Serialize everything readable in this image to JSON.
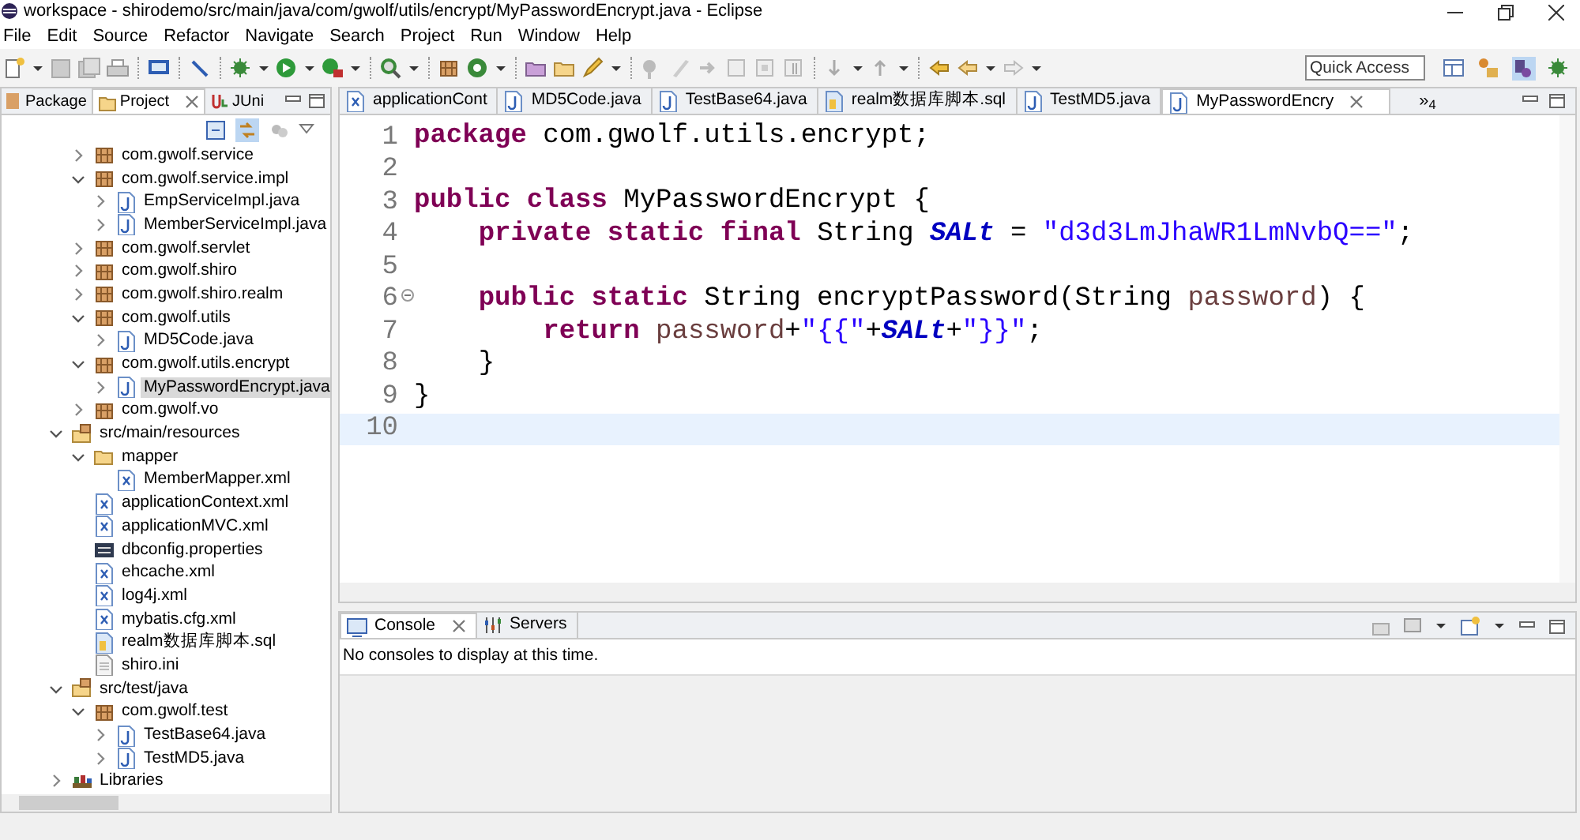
{
  "window": {
    "title": "workspace - shirodemo/src/main/java/com/gwolf/utils/encrypt/MyPasswordEncrypt.java - Eclipse"
  },
  "menu": [
    "File",
    "Edit",
    "Source",
    "Refactor",
    "Navigate",
    "Search",
    "Project",
    "Run",
    "Window",
    "Help"
  ],
  "quick_access": {
    "placeholder": "Quick Access"
  },
  "explorer": {
    "tabs": [
      {
        "label": "Package",
        "selected": false
      },
      {
        "label": "Project",
        "selected": true
      },
      {
        "label": "JUni",
        "selected": false
      }
    ],
    "tree": {
      "continued_children": [
        {
          "label": "com.gwolf.service",
          "kind": "package",
          "expanded": false,
          "selected": false
        },
        {
          "label": "com.gwolf.service.impl",
          "kind": "package",
          "expanded": true,
          "selected": false,
          "children": [
            {
              "label": "EmpServiceImpl.java",
              "kind": "java",
              "expanded": false,
              "selected": false
            },
            {
              "label": "MemberServiceImpl.java",
              "kind": "java",
              "expanded": false,
              "selected": false
            }
          ]
        },
        {
          "label": "com.gwolf.servlet",
          "kind": "package",
          "expanded": false,
          "selected": false
        },
        {
          "label": "com.gwolf.shiro",
          "kind": "package",
          "expanded": false,
          "selected": false
        },
        {
          "label": "com.gwolf.shiro.realm",
          "kind": "package",
          "expanded": false,
          "selected": false
        },
        {
          "label": "com.gwolf.utils",
          "kind": "package",
          "expanded": true,
          "selected": false,
          "children": [
            {
              "label": "MD5Code.java",
              "kind": "java",
              "expanded": false,
              "selected": false
            }
          ]
        },
        {
          "label": "com.gwolf.utils.encrypt",
          "kind": "package",
          "expanded": true,
          "selected": false,
          "children": [
            {
              "label": "MyPasswordEncrypt.java",
              "kind": "java",
              "expanded": false,
              "selected": true
            }
          ]
        },
        {
          "label": "com.gwolf.vo",
          "kind": "package",
          "expanded": false,
          "selected": false
        }
      ],
      "items": [
        {
          "label": "src/main/resources",
          "kind": "source_folder",
          "expanded": true,
          "selected": false,
          "children": [
            {
              "label": "mapper",
              "kind": "folder",
              "expanded": true,
              "selected": false,
              "children": [
                {
                  "label": "MemberMapper.xml",
                  "kind": "xml",
                  "selected": false
                }
              ]
            },
            {
              "label": "applicationContext.xml",
              "kind": "xml",
              "selected": false
            },
            {
              "label": "applicationMVC.xml",
              "kind": "xml",
              "selected": false
            },
            {
              "label": "dbconfig.properties",
              "kind": "properties",
              "selected": false
            },
            {
              "label": "ehcache.xml",
              "kind": "xml",
              "selected": false
            },
            {
              "label": "log4j.xml",
              "kind": "xml",
              "selected": false
            },
            {
              "label": "mybatis.cfg.xml",
              "kind": "xml",
              "selected": false
            },
            {
              "label": "realm数据库脚本.sql",
              "kind": "sql",
              "selected": false
            },
            {
              "label": "shiro.ini",
              "kind": "text",
              "selected": false
            }
          ]
        },
        {
          "label": "src/test/java",
          "kind": "source_folder",
          "expanded": true,
          "selected": false,
          "children": [
            {
              "label": "com.gwolf.test",
              "kind": "package",
              "expanded": true,
              "selected": false,
              "children": [
                {
                  "label": "TestBase64.java",
                  "kind": "java",
                  "expanded": false,
                  "selected": false
                },
                {
                  "label": "TestMD5.java",
                  "kind": "java",
                  "expanded": false,
                  "selected": false
                }
              ]
            }
          ]
        },
        {
          "label": "Libraries",
          "kind": "library",
          "expanded": false,
          "selected": false
        }
      ]
    }
  },
  "editor": {
    "tabs": [
      {
        "label": "applicationCont",
        "kind": "xml",
        "selected": false
      },
      {
        "label": "MD5Code.java",
        "kind": "java",
        "selected": false
      },
      {
        "label": "TestBase64.java",
        "kind": "java",
        "selected": false
      },
      {
        "label": "realm数据库脚本.sql",
        "kind": "sql",
        "selected": false
      },
      {
        "label": "TestMD5.java",
        "kind": "java",
        "selected": false
      },
      {
        "label": "MyPasswordEncry",
        "kind": "java",
        "selected": true
      }
    ],
    "overflow": "»$_{4}$",
    "lines": [
      {
        "number": "1",
        "current": false,
        "foldable": false,
        "tokens": [
          {
            "kind": "keyword",
            "text": "package"
          },
          {
            "kind": "plain",
            "text": " com.gwolf.utils.encrypt;"
          }
        ]
      },
      {
        "number": "2",
        "current": false,
        "foldable": false
      },
      {
        "number": "3",
        "current": false,
        "foldable": false,
        "tokens": [
          {
            "kind": "keyword",
            "text": "public class"
          },
          {
            "kind": "plain",
            "text": " MyPasswordEncrypt {"
          }
        ]
      },
      {
        "number": "4",
        "current": false,
        "foldable": false,
        "tokens": [
          {
            "kind": "keyword",
            "text": "    private static final"
          },
          {
            "kind": "plain",
            "text": " String "
          },
          {
            "kind": "constant",
            "text": "SALt"
          },
          {
            "kind": "plain",
            "text": " = "
          },
          {
            "kind": "string",
            "text": "\"d3d3LmJhaWR1LmNvbQ==\""
          },
          {
            "kind": "plain",
            "text": ";"
          }
        ]
      },
      {
        "number": "5",
        "current": false,
        "foldable": false
      },
      {
        "number": "6",
        "current": false,
        "foldable": true,
        "tokens": [
          {
            "kind": "keyword",
            "text": "    public static"
          },
          {
            "kind": "plain",
            "text": " String encryptPassword(String "
          },
          {
            "kind": "parameter",
            "text": "password"
          },
          {
            "kind": "plain",
            "text": ") {"
          }
        ]
      },
      {
        "number": "7",
        "current": false,
        "foldable": false,
        "tokens": [
          {
            "kind": "keyword",
            "text": "        return"
          },
          {
            "kind": "parameter",
            "text": " password"
          },
          {
            "kind": "plain",
            "text": "+"
          },
          {
            "kind": "string",
            "text": "\"{{\""
          },
          {
            "kind": "plain",
            "text": "+"
          },
          {
            "kind": "constant",
            "text": "SALt"
          },
          {
            "kind": "plain",
            "text": "+"
          },
          {
            "kind": "string",
            "text": "\"}}\""
          },
          {
            "kind": "plain",
            "text": ";"
          }
        ]
      },
      {
        "number": "8",
        "current": false,
        "foldable": false,
        "tokens": [
          {
            "kind": "plain",
            "text": "    }"
          }
        ]
      },
      {
        "number": "9",
        "current": false,
        "foldable": false,
        "tokens": [
          {
            "kind": "plain",
            "text": "}"
          }
        ]
      },
      {
        "number": "10",
        "current": true,
        "foldable": false
      }
    ]
  },
  "console": {
    "tabs": [
      {
        "label": "Console",
        "kind": "console",
        "selected": true
      },
      {
        "label": "Servers",
        "kind": "servers",
        "selected": false
      }
    ],
    "message": "No consoles to display at this time."
  }
}
